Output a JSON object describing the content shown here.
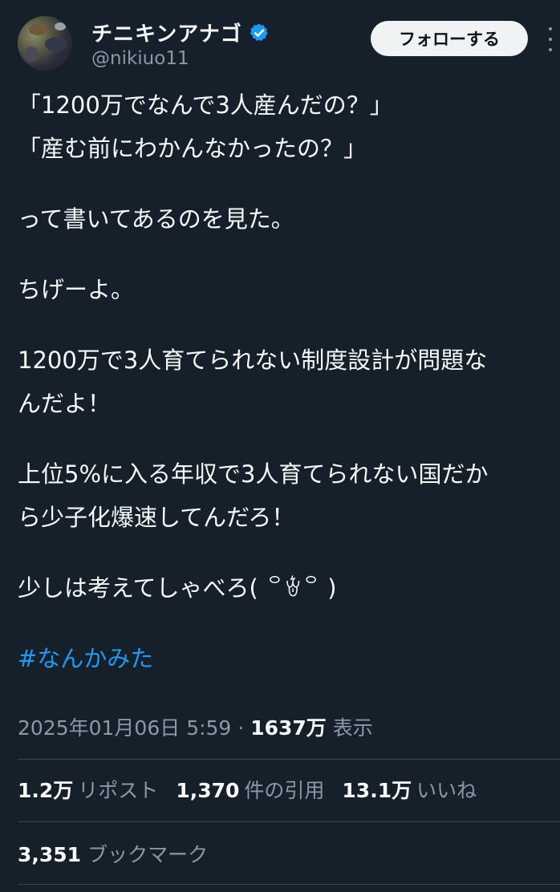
{
  "author": {
    "display_name": "チニキンアナゴ",
    "handle": "@nikiuo11",
    "verified_icon": "verified-badge-icon",
    "follow_label": "フォローする"
  },
  "tweet": {
    "lines": [
      "「1200万でなんで3人産んだの？」",
      "「産む前にわかんなかったの？」",
      "",
      "って書いてあるのを見た。",
      "",
      "ちげーよ。",
      "",
      "1200万で3人育てられない制度設計が問題な",
      "んだよ！",
      "",
      "上位5%に入る年収で3人育てられない国だか",
      "ら少子化爆速してんだろ！",
      "",
      "少しは考えてしゃべろ( ꒪ꄃ꒪ )",
      ""
    ],
    "hashtag": "#なんかみた"
  },
  "meta": {
    "timestamp": "2025年01月06日 5:59",
    "separator": "·",
    "views_count": "1637万",
    "views_label": "表示"
  },
  "stats": {
    "reposts_count": "1.2万",
    "reposts_label": "リポスト",
    "quotes_count": "1,370",
    "quotes_label": "件の引用",
    "likes_count": "13.1万",
    "likes_label": "いいね",
    "bookmarks_count": "3,351",
    "bookmarks_label": "ブックマーク"
  },
  "colors": {
    "background": "#15202b",
    "text": "#f7f9f9",
    "secondary_text": "#8b98a5",
    "accent": "#1d9bf0",
    "divider": "#38444d"
  }
}
